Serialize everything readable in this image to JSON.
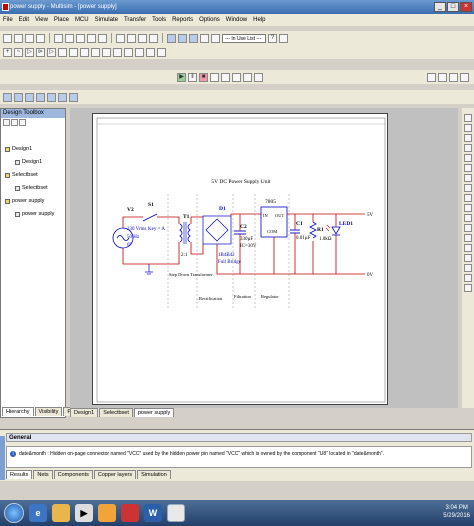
{
  "window": {
    "title": "power supply - Multisim - [power supply]"
  },
  "menu": [
    "File",
    "Edit",
    "View",
    "Place",
    "MCU",
    "Simulate",
    "Transfer",
    "Tools",
    "Reports",
    "Options",
    "Window",
    "Help"
  ],
  "toolbar": {
    "in_use_list": "--- In Use List ---"
  },
  "design_toolbox": {
    "title": "Design Toolbox",
    "items": [
      {
        "label": "Design1",
        "level": 0
      },
      {
        "label": "Design1",
        "level": 1
      },
      {
        "label": "Selectbset",
        "level": 0
      },
      {
        "label": "Selectbset",
        "level": 1
      },
      {
        "label": "power supply",
        "level": 0
      },
      {
        "label": "power supply",
        "level": 1
      }
    ],
    "tabs": [
      "Hierarchy",
      "Visibility",
      "Project View"
    ]
  },
  "sheet_tabs": [
    "Design1",
    "Selectbset",
    "power supply"
  ],
  "schematic": {
    "title": "5V DC Power Supply Unit",
    "source": {
      "ref": "V2",
      "line1": "230 Vrms",
      "line2": "50 Hz",
      "line3": "0°"
    },
    "switch": {
      "ref": "S1",
      "key": "Key = A"
    },
    "transformer": {
      "ref": "T1",
      "ratio": "2:1"
    },
    "bridge": {
      "ref": "D1",
      "part": "1B4B42",
      "name": "Full Bridge"
    },
    "cap_filter": {
      "ref": "C2",
      "value": "330µF",
      "voltage": "IC=30V"
    },
    "regulator": {
      "ref": "7805",
      "pin_in": "IN",
      "pin_out": "OUT",
      "pin_com": "COM"
    },
    "cap_out": {
      "ref": "C1",
      "value": "0.01µF"
    },
    "resistor": {
      "ref": "R1",
      "value": "1.0kΩ"
    },
    "led": {
      "ref": "LED1"
    },
    "output_pos": "5V",
    "output_neg": "0V",
    "stages": [
      "Step Down Transformer",
      "Rectification",
      "Filtration",
      "Regulator"
    ]
  },
  "spreadsheet": {
    "header": "General",
    "message": "date&month : Hidden on-page connector named \"VCC\" used by the hidden power pin named \"VCC\" which is owned by the component \"U8\" located in \"date&month\".",
    "tabs": [
      "Results",
      "Nets",
      "Components",
      "Copper layers",
      "Simulation"
    ]
  },
  "taskbar": {
    "time": "3:04 PM",
    "date": "5/29/2016"
  },
  "colors": {
    "wire": "#c00000",
    "component": "#0000cc",
    "titlebar": "#3a6db0"
  }
}
